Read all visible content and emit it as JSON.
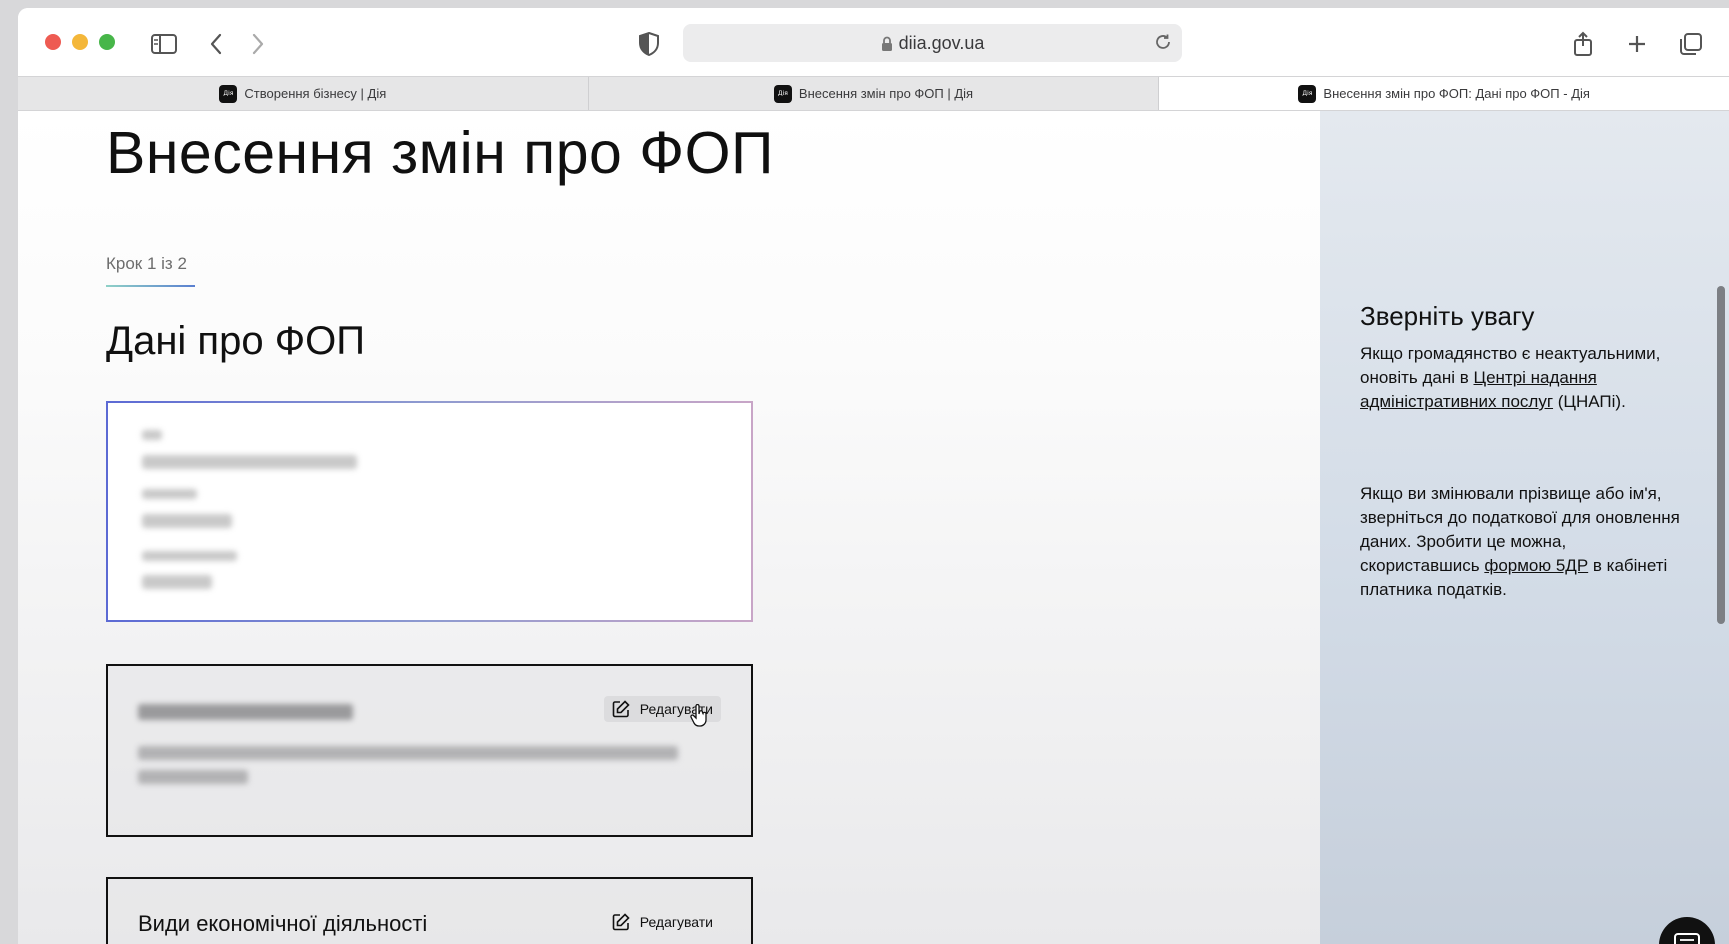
{
  "browser": {
    "url": "diia.gov.ua",
    "tabs": [
      {
        "label": "Створення бізнесу | Дія",
        "favicon": "Дія"
      },
      {
        "label": "Внесення змін про ФОП | Дія",
        "favicon": "Дія"
      },
      {
        "label": "Внесення змін про ФОП: Дані про ФОП - Дія",
        "favicon": "Дія"
      }
    ],
    "active_tab": 2
  },
  "page": {
    "title": "Внесення змін про ФОП",
    "step": "Крок 1 із 2",
    "section_title": "Дані про ФОП",
    "cards": [
      {
        "title": "",
        "edit_label": ""
      },
      {
        "title": "",
        "edit_label": "Редагувати"
      },
      {
        "title": "Види економічної діяльності",
        "edit_label": "Редагувати"
      }
    ]
  },
  "side": {
    "title": "Зверніть увагу",
    "p1_before": "Якщо громадянство є неактуальними, оновіть дані в ",
    "p1_link": "Центрі надання адміністративних послуг",
    "p1_after": " (ЦНАПі).",
    "p2_before": "Якщо ви змінювали прізвище або ім'я, зверніться до податкової для оновлення даних. Зробити це можна, скориставшись ",
    "p2_link": "формою 5ДР",
    "p2_after": " в кабінеті платника податків."
  },
  "colors": {
    "traffic_red": "#ee5b52",
    "traffic_yellow": "#f4b73a",
    "traffic_green": "#47b649",
    "side_panel": "#d3dce7"
  },
  "icons": [
    "sidebar-icon",
    "back-icon",
    "forward-icon",
    "shield-icon",
    "lock-icon",
    "reload-icon",
    "share-icon",
    "plus-icon",
    "tabs-icon",
    "edit-icon",
    "chat-icon"
  ]
}
